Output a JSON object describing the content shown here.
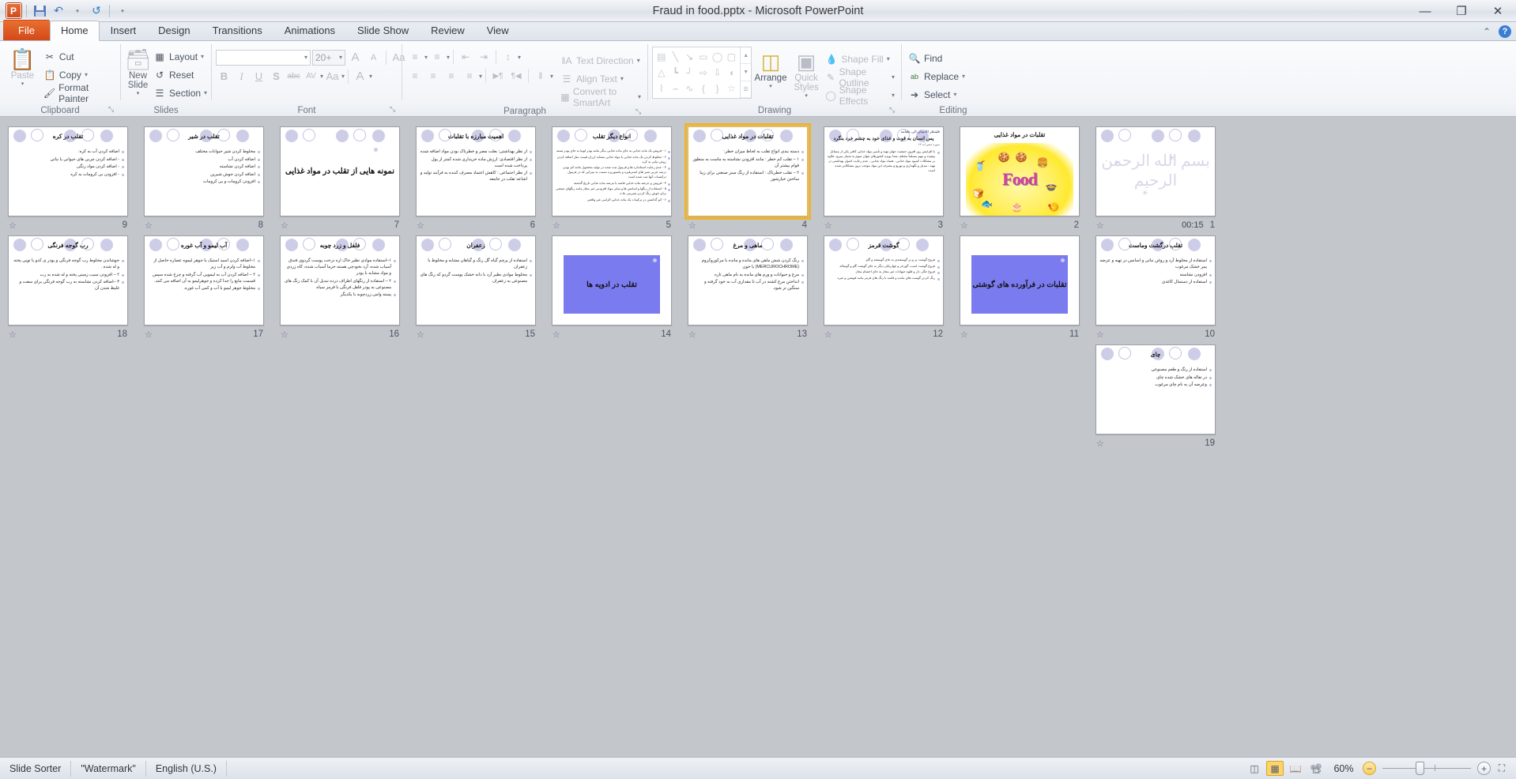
{
  "window": {
    "title": "Fraud in food.pptx  -  Microsoft PowerPoint",
    "minimize": "—",
    "restore": "❐",
    "close": "✕"
  },
  "quick_access": {
    "app_logo": "P",
    "save": "save-icon",
    "undo": "↶",
    "undo_caret": "▾",
    "redo": "↺",
    "customize_caret": "▾"
  },
  "tabs": [
    {
      "label": "File",
      "type": "file"
    },
    {
      "label": "Home",
      "type": "active"
    },
    {
      "label": "Insert",
      "type": "normal"
    },
    {
      "label": "Design",
      "type": "normal"
    },
    {
      "label": "Transitions",
      "type": "normal"
    },
    {
      "label": "Animations",
      "type": "normal"
    },
    {
      "label": "Slide Show",
      "type": "normal"
    },
    {
      "label": "Review",
      "type": "normal"
    },
    {
      "label": "View",
      "type": "normal"
    }
  ],
  "tab_right": {
    "minimize_ribbon": "⌃",
    "help": "?"
  },
  "ribbon": {
    "clipboard": {
      "group_label": "Clipboard",
      "paste": "Paste",
      "paste_caret": "▾",
      "cut": "Cut",
      "copy": "Copy",
      "copy_caret": "▾",
      "format_painter": "Format Painter",
      "dialog_launcher": "⤡"
    },
    "slides": {
      "group_label": "Slides",
      "new_slide": "New Slide",
      "new_slide_caret": "▾",
      "layout": "Layout",
      "layout_caret": "▾",
      "reset": "Reset",
      "section": "Section",
      "section_caret": "▾"
    },
    "font": {
      "group_label": "Font",
      "font_name": "",
      "font_size": "20+",
      "grow_font": "A",
      "shrink_font": "A",
      "clear_formatting": "Aa",
      "bold": "B",
      "italic": "I",
      "underline": "U",
      "shadow": "S",
      "strikethrough": "abc",
      "character_spacing": "AV",
      "change_case": "Aa",
      "font_color": "A",
      "dialog_launcher": "⤡"
    },
    "paragraph": {
      "group_label": "Paragraph",
      "bullets": "≡",
      "numbering": "≡",
      "decrease_indent": "⇤",
      "increase_indent": "⇥",
      "line_spacing": "↕",
      "align_left": "≡",
      "align_center": "≡",
      "align_right": "≡",
      "justify": "≡",
      "ltr": "▶¶",
      "rtl": "¶◀",
      "columns": "‖",
      "text_direction": "Text Direction",
      "align_text": "Align Text",
      "convert_to_smartart": "Convert to SmartArt",
      "dialog_launcher": "⤡"
    },
    "drawing": {
      "group_label": "Drawing",
      "shapes": [
        "▤",
        "╲",
        "↘",
        "▭",
        "◯",
        "▢",
        "△",
        "┗",
        "┘",
        "⇨",
        "⇩",
        "◖",
        "⌇",
        "⌢",
        "∿",
        "{",
        "}",
        "☆"
      ],
      "scroll_up": "▲",
      "scroll_down": "▼",
      "scroll_more": "☰",
      "arrange": "Arrange",
      "arrange_caret": "▾",
      "quick_styles": "Quick Styles",
      "quick_styles_caret": "▾",
      "shape_fill": "Shape Fill",
      "shape_outline": "Shape Outline",
      "shape_effects": "Shape Effects",
      "caret": "▾",
      "dialog_launcher": "⤡"
    },
    "editing": {
      "group_label": "Editing",
      "find": "Find",
      "replace": "Replace",
      "replace_caret": "▾",
      "select": "Select",
      "select_caret": "▾"
    }
  },
  "slide_sorter": {
    "anim_icon": "☆",
    "rows": [
      [
        {
          "number": "9",
          "kind": "bullets",
          "title": "تقلب در کره",
          "lines": [
            "اضافه کردن آب به کره:",
            "- اضافه کردن چربی های حیوانی یا نباتی",
            "- اضافه کردن مواد  رنگی",
            "- افزودن بی کرومات به کره"
          ]
        },
        {
          "number": "8",
          "kind": "bullets",
          "title": "تقلب در شیر",
          "lines": [
            "مخلوط  کردن شیر حیوانات مختلف",
            "اضافه کردن آب",
            "اضافه کردن نشاسته",
            "اضافه کردن جوش شیرین",
            "افزودن کرومات و بی کرومات"
          ]
        },
        {
          "number": "7",
          "kind": "center",
          "title": "نمونه هایی از تقلب در مواد غذایی",
          "lines": []
        },
        {
          "number": "6",
          "kind": "bullets",
          "title": "اهمیت مبارزه با تقلبات",
          "lines": [
            "از نظر بهداشتی: بعلت مضر و خطرناک بودن مواد اضافه شده",
            "از نظر اقتصادی: ارزش ماده خریداری شده کمتر از پول پرداخت شده است",
            "از نظر اجتماعی : کاهش اعتماد مصرف کننده به فرآیند تولید و اشاعه تقلب در جامعه"
          ]
        },
        {
          "number": "5",
          "kind": "dense",
          "title": "انواع دیگر تقلب",
          "lines": [
            "۱ -  فروش یک ماده غذایی به جای ماده غذایی دیگر مانند پودر لوبیا به جای پودر پسته",
            "۲ -  مخلوط کردن یک ماده غذایی با مواد غذایی مشابه ارزان قیمت مثل اضافه کردن روغن نباتی به کره",
            "۳ -  عدم رعایت استاندارد ها و فرمول ثبت شده در تولید محصول مانند کم بودن درصد چربی شیر های استریلیزه و پاستوریزه نسبت به میزانی که در فرمول درکیسات آنها ثبت شده است",
            "۴ -  فروش و عرضه  ماده غذایی فاسد یا مرضه ماده غذایی تاریخ گذشته",
            "۵ -  استفاده از رنگها و اسانس ها و سایر مواد افزودنی غیر مجاز مانند رنگهای صنعتی برای خوش رنگ کردن شیرینی جات",
            "۶ -  کم گذاشتن در ترکیبات یک ماده غذایی الزامی غیر واقعی"
          ]
        },
        {
          "number": "4",
          "kind": "bullets",
          "selected": true,
          "title": "تقلبات در مواد غذایی",
          "lines": [
            "دسته بندی انواع تقلب به لحاظ میزان خطر:",
            "۱ – تقلب کم خطر : مانند افزودن نشاسته به ماست به منظور قوام بیشتر آن",
            "۲ – تقلب خطرناک : استفاده از رنگ سبز صنعتی برای زیبا ساختن خیارشور"
          ]
        },
        {
          "number": "3",
          "kind": "dense-head",
          "title": "فلینظر الانسان الی طعامه",
          "subtitle": "پس انسان به قوت و غذای خود به چشم خرد بنگرد",
          "ref": "سوره عبس آیه ۲۴",
          "lines": [
            "با افزایش روز افزون جمعیت جهان تهیه و تأمین مواد غذایی کافی یکی از مسائل پیچیده و مهم  مسلماً مختلف شدا بویژه کشورهای جهان سوم به شمار میرود علاوه بر مشکلات کمبود مواد غذایی ، فساد مواد غذایی ، عدم رعایت اصول بهداشتی در تهیه ، تبدیل و نگهداری و توزیع و مصرف این مواد موجب بروز مشکلاتی شده است"
          ]
        },
        {
          "number": "2",
          "kind": "image",
          "title": "تقلبات در مواد غذایی",
          "art_word": "Food",
          "lines": []
        },
        {
          "number": "1",
          "kind": "bism",
          "timing": "00:15",
          "title": "",
          "bism": "بسم الله الرحمن الرحیم",
          "lines": []
        }
      ],
      [
        {
          "number": "18",
          "kind": "bullets",
          "title": "رب گوجه فرنگی",
          "lines": [
            "جوشاندن مخلوط رب گوجه فرنگی و پودر ی کدو یا تویی پخته و له شده .",
            "۲ – افزودن سیب زمینی پخته و له شده به رب",
            "۳ –اضافه کردن نشاسته به رب گوجه فرنگی برای سفت و غلیظ شدن آن"
          ]
        },
        {
          "number": "17",
          "kind": "bullets",
          "title": "آب لیمو و آب غوره",
          "lines": [
            "۱–اضافه کردن اسید استیک یا جوهر لیموه عصاره حاصل از مخلوط آب ولرم و آب زیر",
            "۲ – اضافه کردن آب به لیمویی آب گرفته و چرخ شده سپس قسمت مایع را جدا کرده و جوهرلیمو به آن اضافه می کنند.",
            "مخلوط جوهر لیمو با آب و کمی آب غوره."
          ]
        },
        {
          "number": "16",
          "kind": "bullets",
          "title": "فلفل  و زرد چوبه",
          "lines": [
            "۱–استفاده موادی نظیر خاک اره درخت  پوست گردوی فندق آسیاب شده، آرد نخودچی هسته خرما آسیاب شده، کاه زردی و مواد مشابه با پودر",
            "۲ – استفاده از رنگهای اطراف درده تبدیل  آن با کمک رنگ های مصنوعی به پودر فلفل فرنگی با قرمز سیاه",
            "پسته وامی زردچوبه با یکدیگر"
          ]
        },
        {
          "number": "15",
          "kind": "bullets",
          "title": "زعفران",
          "lines": [
            "استفاده از پرچم گیاه گل رنگ و گیاهان مشابه و مخلوط با زعفران",
            "مخلوط موادی نظیر آرد با دانه خشک پوست گردو که رنگ های مصنوعی به زعفران"
          ]
        },
        {
          "number": "14",
          "kind": "blue",
          "title": "تقلب در ادویه ها",
          "lines": []
        },
        {
          "number": "13",
          "kind": "bullets",
          "title": "ماهی و مرغ",
          "lines": [
            "رنگ کردن شش ماهی های مانده و مانده با مرکوروکروم (MERCUROCHROME) یا خون",
            "مرغ و حیوانات و ورم های مانده به نام ماهی تازه",
            "انداختن مرغ کشته در آب تا مقداری آب به خود گرفته و سنگین تر شود."
          ]
        },
        {
          "number": "12",
          "kind": "dense2",
          "title": "گوشت قرمز",
          "lines": [
            "فروخ گوشت بز و بز گوسفندی به جای گوسفند و گاو",
            "فروخ  گوشت اسب، گورخر و چهارپایان دیگر به جای گوشت گاو و گوساله",
            "فروخ  جگر، دل و قلوه حیوانات غیر مجاز به جای احشام مجاز",
            "رنگ کردن گوشت های مانده و فاسد با رنگ های قرمز مانند فوشین و غیره"
          ]
        },
        {
          "number": "11",
          "kind": "blue",
          "title": "تقلبات در فرآورده های گوشتی",
          "lines": []
        },
        {
          "number": "10",
          "kind": "bullets",
          "title": "تقلب درگشت وماست",
          "lines": [
            "استفاده از مخلوط آرد و روغن نباتی و اسانس در تهیه و عرضه پنیر خشک مرغوب",
            "افزودن نشاسته",
            "استفاده از دستمال کاغذی"
          ]
        }
      ],
      [
        {
          "number": "19",
          "kind": "bullets",
          "title": "چای",
          "lines": [
            "استفاده از رنگ و طعم مصنوعی",
            "در تفاله های خشک شده چای",
            "وعرضه  آن به نام چای مرغوب"
          ]
        }
      ]
    ]
  },
  "status_bar": {
    "view_mode": "Slide Sorter",
    "theme": "\"Watermark\"",
    "language": "English (U.S.)",
    "view_normal": "normal-view-icon",
    "view_slide_sorter": "slide-sorter-icon",
    "view_reading": "reading-view-icon",
    "view_slideshow": "slideshow-icon",
    "zoom_level": "60%",
    "zoom_out": "−",
    "zoom_in": "+",
    "fit_to_window": "fit-icon"
  }
}
